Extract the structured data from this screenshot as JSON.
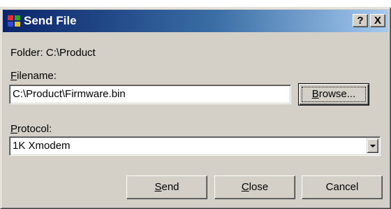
{
  "dialog": {
    "title": "Send File",
    "help_button": "?",
    "close_button": "X"
  },
  "folder": {
    "label": "Folder:",
    "value": "C:\\Product"
  },
  "filename": {
    "label_accel": "F",
    "label_rest": "ilename:",
    "value": "C:\\Product\\Firmware.bin"
  },
  "browse": {
    "accel": "B",
    "rest": "rowse..."
  },
  "protocol": {
    "label_accel": "P",
    "label_rest": "rotocol:",
    "selected": "1K Xmodem"
  },
  "buttons": {
    "send_accel": "S",
    "send_rest": "end",
    "close_accel": "C",
    "close_rest": "lose",
    "cancel": "Cancel"
  },
  "colors": {
    "titlebar_start": "#0a246a",
    "titlebar_end": "#a6caf0",
    "face": "#d4d0c8"
  }
}
